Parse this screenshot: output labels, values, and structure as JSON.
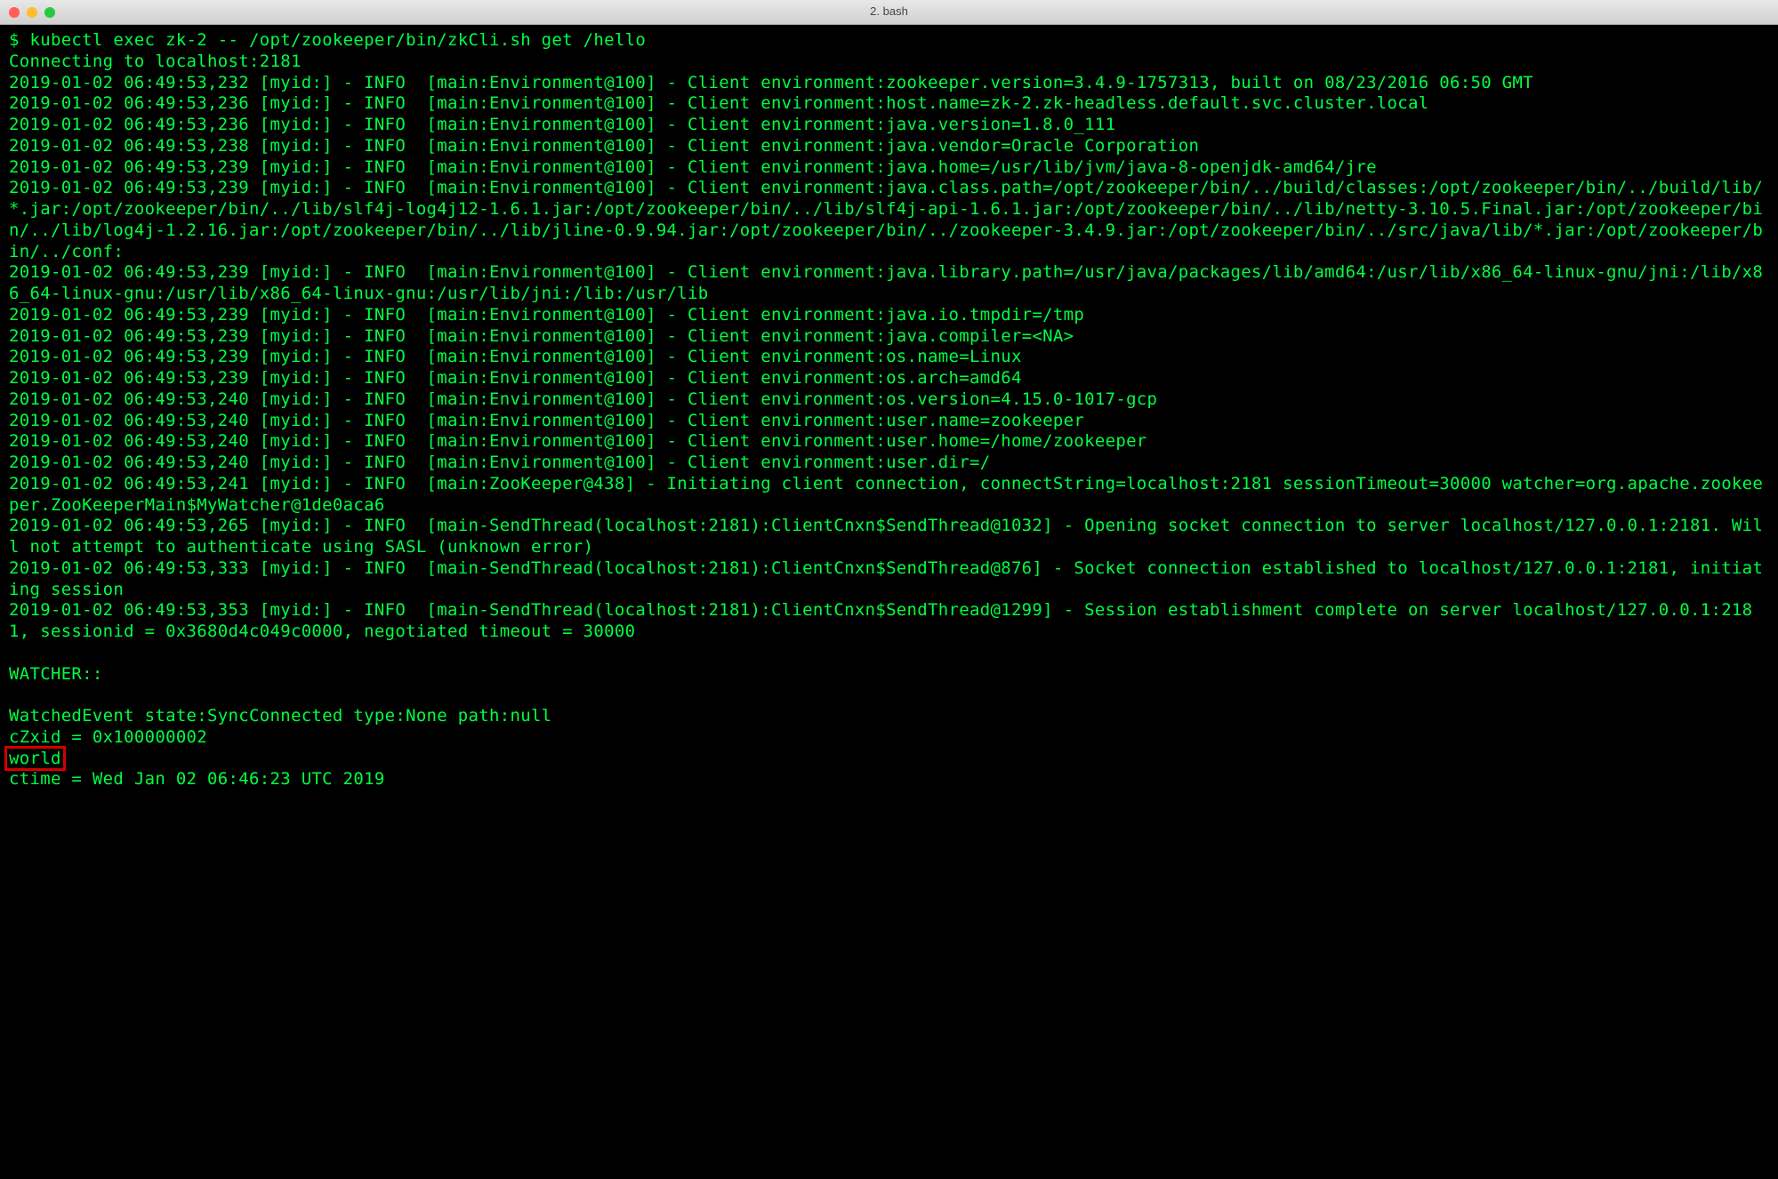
{
  "window": {
    "title": "2. bash"
  },
  "terminal": {
    "prompt": "$ ",
    "command": "kubectl exec zk-2 -- /opt/zookeeper/bin/zkCli.sh get /hello",
    "lines": [
      "Connecting to localhost:2181",
      "2019-01-02 06:49:53,232 [myid:] - INFO  [main:Environment@100] - Client environment:zookeeper.version=3.4.9-1757313, built on 08/23/2016 06:50 GMT",
      "2019-01-02 06:49:53,236 [myid:] - INFO  [main:Environment@100] - Client environment:host.name=zk-2.zk-headless.default.svc.cluster.local",
      "2019-01-02 06:49:53,236 [myid:] - INFO  [main:Environment@100] - Client environment:java.version=1.8.0_111",
      "2019-01-02 06:49:53,238 [myid:] - INFO  [main:Environment@100] - Client environment:java.vendor=Oracle Corporation",
      "2019-01-02 06:49:53,239 [myid:] - INFO  [main:Environment@100] - Client environment:java.home=/usr/lib/jvm/java-8-openjdk-amd64/jre",
      "2019-01-02 06:49:53,239 [myid:] - INFO  [main:Environment@100] - Client environment:java.class.path=/opt/zookeeper/bin/../build/classes:/opt/zookeeper/bin/../build/lib/*.jar:/opt/zookeeper/bin/../lib/slf4j-log4j12-1.6.1.jar:/opt/zookeeper/bin/../lib/slf4j-api-1.6.1.jar:/opt/zookeeper/bin/../lib/netty-3.10.5.Final.jar:/opt/zookeeper/bin/../lib/log4j-1.2.16.jar:/opt/zookeeper/bin/../lib/jline-0.9.94.jar:/opt/zookeeper/bin/../zookeeper-3.4.9.jar:/opt/zookeeper/bin/../src/java/lib/*.jar:/opt/zookeeper/bin/../conf:",
      "2019-01-02 06:49:53,239 [myid:] - INFO  [main:Environment@100] - Client environment:java.library.path=/usr/java/packages/lib/amd64:/usr/lib/x86_64-linux-gnu/jni:/lib/x86_64-linux-gnu:/usr/lib/x86_64-linux-gnu:/usr/lib/jni:/lib:/usr/lib",
      "2019-01-02 06:49:53,239 [myid:] - INFO  [main:Environment@100] - Client environment:java.io.tmpdir=/tmp",
      "2019-01-02 06:49:53,239 [myid:] - INFO  [main:Environment@100] - Client environment:java.compiler=<NA>",
      "2019-01-02 06:49:53,239 [myid:] - INFO  [main:Environment@100] - Client environment:os.name=Linux",
      "2019-01-02 06:49:53,239 [myid:] - INFO  [main:Environment@100] - Client environment:os.arch=amd64",
      "2019-01-02 06:49:53,240 [myid:] - INFO  [main:Environment@100] - Client environment:os.version=4.15.0-1017-gcp",
      "2019-01-02 06:49:53,240 [myid:] - INFO  [main:Environment@100] - Client environment:user.name=zookeeper",
      "2019-01-02 06:49:53,240 [myid:] - INFO  [main:Environment@100] - Client environment:user.home=/home/zookeeper",
      "2019-01-02 06:49:53,240 [myid:] - INFO  [main:Environment@100] - Client environment:user.dir=/",
      "2019-01-02 06:49:53,241 [myid:] - INFO  [main:ZooKeeper@438] - Initiating client connection, connectString=localhost:2181 sessionTimeout=30000 watcher=org.apache.zookeeper.ZooKeeperMain$MyWatcher@1de0aca6",
      "2019-01-02 06:49:53,265 [myid:] - INFO  [main-SendThread(localhost:2181):ClientCnxn$SendThread@1032] - Opening socket connection to server localhost/127.0.0.1:2181. Will not attempt to authenticate using SASL (unknown error)",
      "2019-01-02 06:49:53,333 [myid:] - INFO  [main-SendThread(localhost:2181):ClientCnxn$SendThread@876] - Socket connection established to localhost/127.0.0.1:2181, initiating session",
      "2019-01-02 06:49:53,353 [myid:] - INFO  [main-SendThread(localhost:2181):ClientCnxn$SendThread@1299] - Session establishment complete on server localhost/127.0.0.1:2181, sessionid = 0x3680d4c049c0000, negotiated timeout = 30000",
      "",
      "WATCHER::",
      "",
      "WatchedEvent state:SyncConnected type:None path:null",
      "cZxid = 0x100000002"
    ],
    "highlighted": "world",
    "after_highlight": [
      "ctime = Wed Jan 02 06:46:23 UTC 2019"
    ]
  }
}
